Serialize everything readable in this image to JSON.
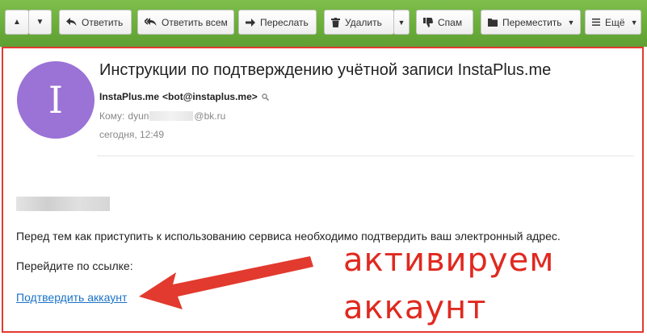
{
  "toolbar": {
    "reply": "Ответить",
    "reply_all": "Ответить всем",
    "forward": "Переслать",
    "delete": "Удалить",
    "spam": "Спам",
    "move": "Переместить",
    "more": "Ещё"
  },
  "message": {
    "avatar_letter": "I",
    "subject": "Инструкции по подтверждению учётной записи InstaPlus.me",
    "from_name": "InstaPlus.me",
    "from_email": "<bot@instaplus.me>",
    "to_label": "Кому:",
    "to_prefix": "dyun",
    "to_suffix": "@bk.ru",
    "date": "сегодня, 12:49",
    "body_line1": "Перед тем как приступить к использованию сервиса необходимо подтвердить ваш электронный адрес.",
    "body_line2": "Перейдите по ссылке:",
    "link_text": "Подтвердить аккаунт"
  },
  "annotation": {
    "line1": "активируем",
    "line2": "аккаунт",
    "color": "#e0291f"
  },
  "colors": {
    "toolbar_green": "#6aae3a",
    "frame_red": "#e23a2e",
    "avatar_purple": "#9b72d6",
    "link_blue": "#1a73c8"
  }
}
